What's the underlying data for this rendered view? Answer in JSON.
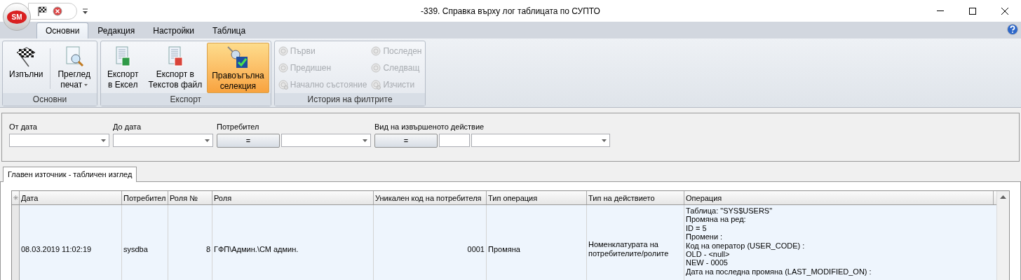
{
  "window": {
    "title": "-339. Справка върху лог таблицата по СУПТО",
    "app_button": "SM"
  },
  "ribbon_tabs": [
    {
      "label": "Основни",
      "selected": true
    },
    {
      "label": "Редакция",
      "selected": false
    },
    {
      "label": "Настройки",
      "selected": false
    },
    {
      "label": "Таблица",
      "selected": false
    }
  ],
  "ribbon_groups": [
    {
      "title": "Основни",
      "kind": "large",
      "buttons": [
        {
          "lines": [
            "Изпълни"
          ],
          "dropdown": false,
          "selected": false
        },
        {
          "lines": [
            "Преглед",
            "печат"
          ],
          "dropdown": true,
          "selected": false
        }
      ]
    },
    {
      "title": "Експорт",
      "kind": "large",
      "buttons": [
        {
          "lines": [
            "Експорт",
            "в Ексел"
          ],
          "dropdown": false,
          "selected": false
        },
        {
          "lines": [
            "Експорт в",
            "Текстов файл"
          ],
          "dropdown": false,
          "selected": false
        },
        {
          "lines": [
            "Правоъгълна",
            "селекция"
          ],
          "dropdown": false,
          "selected": true
        }
      ]
    },
    {
      "title": "История на филтрите",
      "kind": "small",
      "columns": [
        [
          {
            "label": "Първи",
            "disabled": true
          },
          {
            "label": "Предишен",
            "disabled": true
          },
          {
            "label": "Начално състояние",
            "disabled": true
          }
        ],
        [
          {
            "label": "Последен",
            "disabled": true
          },
          {
            "label": "Следващ",
            "disabled": true
          },
          {
            "label": "Изчисти",
            "disabled": true
          }
        ]
      ]
    }
  ],
  "filters": [
    {
      "label": "От дата",
      "kind": "combo"
    },
    {
      "label": "До дата",
      "kind": "combo"
    },
    {
      "label": "Потребител",
      "kind": "operator_combo",
      "operator": "="
    },
    {
      "label": "Вид на извършеното действие",
      "kind": "operator_code_combo",
      "operator": "="
    }
  ],
  "view_tabs": [
    {
      "label": "Главен източник - табличен изглед",
      "selected": true
    }
  ],
  "table": {
    "columns": [
      "Дата",
      "Потребител",
      "Роля №",
      "Роля",
      "Уникален код на потребителя",
      "Тип операция",
      "Тип на действието",
      "Операция"
    ],
    "rows": [
      {
        "selected": true,
        "cells": [
          "08.03.2019 11:02:19",
          "sysdba",
          "8",
          "ГФП\\Админ.\\СМ админ.",
          "0001",
          "Промяна",
          "Номенклатурата на потребителите/ролите"
        ],
        "operation_lines": [
          "Таблица: \"SYS$USERS\"",
          "Промяна на ред:",
          "ID = 5",
          "Промени :",
          "Код на оператор (USER_CODE) :",
          "OLD - <null>",
          "NEW - 0005",
          "Дата на последна промяна (LAST_MODIFIED_ON) :"
        ]
      }
    ]
  }
}
